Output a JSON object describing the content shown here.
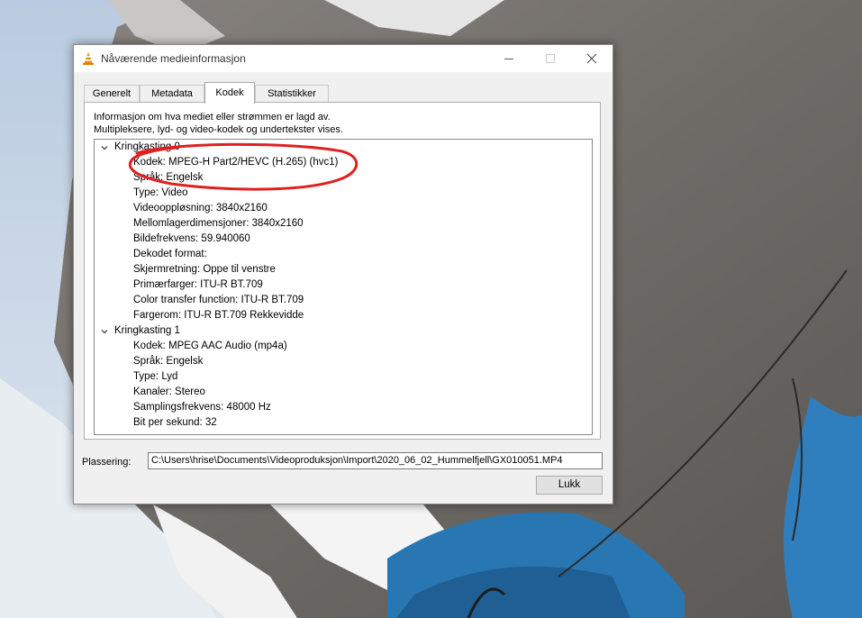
{
  "window": {
    "title": "Nåværende medieinformasjon"
  },
  "tabs": [
    {
      "label": "Generelt"
    },
    {
      "label": "Metadata"
    },
    {
      "label": "Kodek"
    },
    {
      "label": "Statistikker"
    }
  ],
  "active_tab": "Kodek",
  "description": {
    "line1": "Informasjon om hva mediet eller strømmen er lagd av.",
    "line2": "Multipleksere, lyd- og video-kodek og undertekster vises."
  },
  "streams": [
    {
      "label": "Kringkasting 0",
      "expanded": true,
      "items": [
        "Kodek: MPEG-H Part2/HEVC (H.265) (hvc1)",
        "Språk: Engelsk",
        "Type: Video",
        "Videooppløsning: 3840x2160",
        "Mellomlagerdimensjoner: 3840x2160",
        "Bildefrekvens: 59.940060",
        "Dekodet format:",
        "Skjermretning: Oppe til venstre",
        "Primærfarger: ITU-R BT.709",
        "Color transfer function: ITU-R BT.709",
        "Fargerom: ITU-R BT.709 Rekkevidde"
      ]
    },
    {
      "label": "Kringkasting 1",
      "expanded": true,
      "items": [
        "Kodek: MPEG AAC Audio (mp4a)",
        "Språk: Engelsk",
        "Type: Lyd",
        "Kanaler: Stereo",
        "Samplingsfrekvens: 48000 Hz",
        "Bit per sekund: 32"
      ]
    }
  ],
  "location": {
    "label": "Plassering:",
    "value": "C:\\Users\\hrise\\Documents\\Videoproduksjon\\Import\\2020_06_02_Hummelfjell\\GX010051.MP4"
  },
  "close_button": "Lukk",
  "icons": {
    "app": "vlc-cone-icon",
    "minimize": "minimize-icon",
    "maximize": "maximize-icon",
    "close": "close-icon",
    "expand": "chevron-down-icon"
  },
  "colors": {
    "annotation": "#e02020",
    "vlc_orange": "#f08a00"
  }
}
